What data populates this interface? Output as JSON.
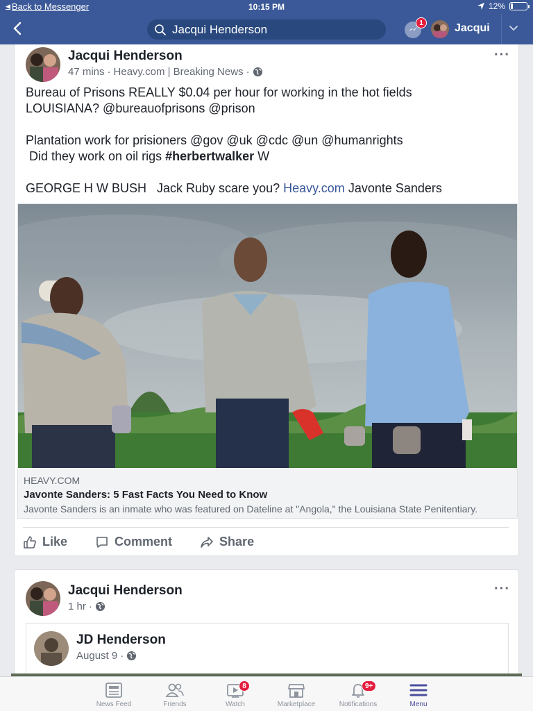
{
  "status_bar": {
    "back_label": "Back to Messenger",
    "time": "10:15 PM",
    "battery": "12%",
    "battery_level": 0.12
  },
  "header": {
    "search_value": "Jacqui Henderson",
    "messenger_badge": "1",
    "profile_name": "Jacqui"
  },
  "post1": {
    "author": "Jacqui Henderson",
    "time": "47 mins",
    "source": "Heavy.com | Breaking News",
    "text": {
      "line1": "Bureau of Prisons REALLY $0.04 per hour for working in the hot fields",
      "line2": "LOUISIANA? @bureauofprisons @prison",
      "line3": "Plantation work for prisioners @gov @uk @cdc @un @humanrights",
      "line4_pre": " Did they work on oil rigs ",
      "line4_hashtag": "#herbertwalker",
      "line4_post": " W",
      "line5_pre": "GEORGE H W BUSH   Jack Ruby scare you? ",
      "line5_link": "Heavy.com",
      "line5_post": " Javonte Sanders"
    },
    "link": {
      "domain": "HEAVY.COM",
      "title": "Javonte Sanders: 5 Fast Facts You Need to Know",
      "description": "Javonte Sanders is an inmate who was featured on Dateline at \"Angola,\" the Louisiana State Penitentiary."
    },
    "actions": {
      "like": "Like",
      "comment": "Comment",
      "share": "Share"
    }
  },
  "post2": {
    "author": "Jacqui Henderson",
    "time": "1 hr",
    "shared_author": "JD Henderson",
    "shared_date": "August 9"
  },
  "tabs": [
    {
      "label": "News Feed",
      "icon": "news-feed-icon",
      "badge": ""
    },
    {
      "label": "Friends",
      "icon": "friends-icon",
      "badge": ""
    },
    {
      "label": "Watch",
      "icon": "watch-icon",
      "badge": "8"
    },
    {
      "label": "Marketplace",
      "icon": "marketplace-icon",
      "badge": ""
    },
    {
      "label": "Notifications",
      "icon": "bell-icon",
      "badge": "9+"
    },
    {
      "label": "Menu",
      "icon": "menu-icon",
      "badge": ""
    }
  ],
  "colors": {
    "brand": "#3b5998",
    "link": "#385898",
    "active_tab": "#4b4f9e",
    "badge": "#e41e3f"
  }
}
